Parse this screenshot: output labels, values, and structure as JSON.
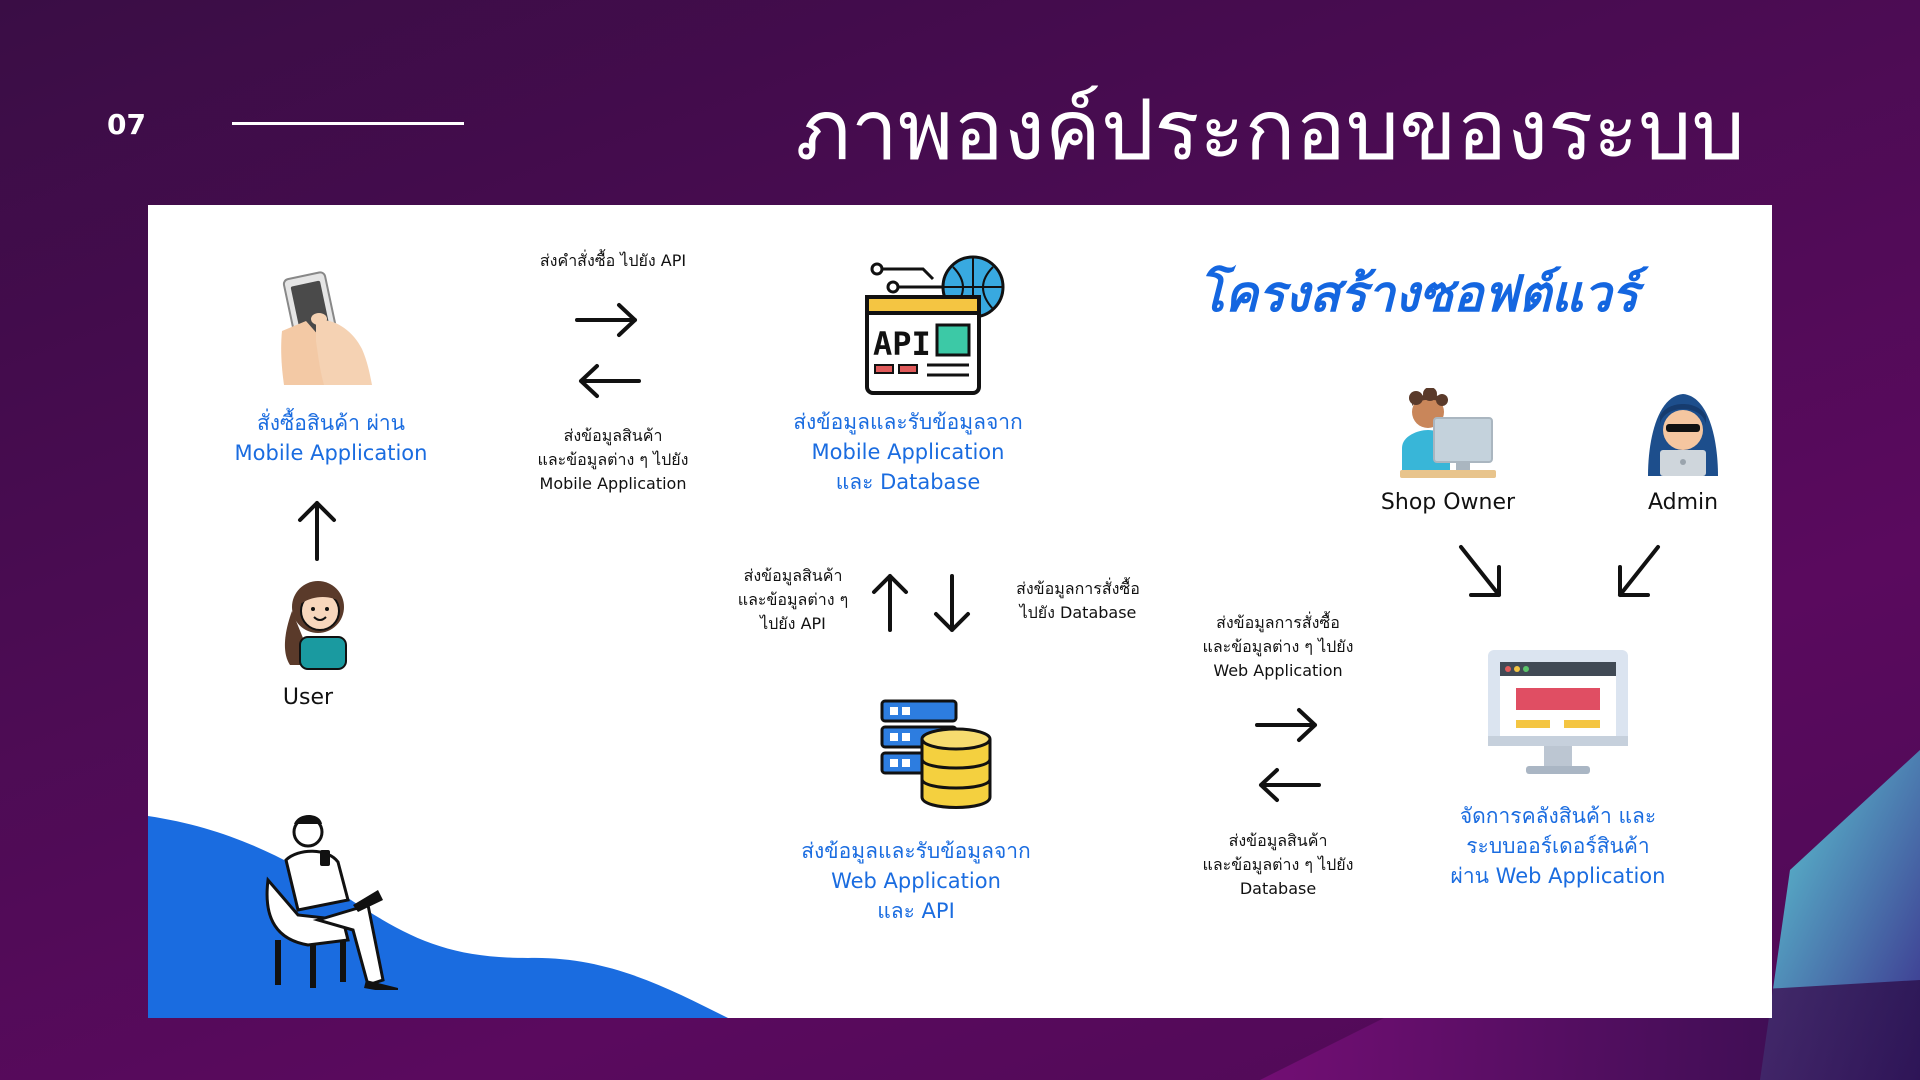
{
  "slide": {
    "number": "07",
    "title": "ภาพองค์ประกอบของระบบ"
  },
  "diagram": {
    "heading": "โครงสร้างซอฟต์แวร์",
    "user": {
      "label": "User",
      "action_lines": [
        "สั่งซื้อสินค้า ผ่าน",
        "Mobile Application"
      ]
    },
    "api": {
      "lines": [
        "ส่งข้อมูลและรับข้อมูลจาก",
        "Mobile Application",
        "และ Database"
      ]
    },
    "database": {
      "lines": [
        "ส่งข้อมูลและรับข้อมูลจาก",
        "Web Application",
        "และ API"
      ]
    },
    "web_app": {
      "lines": [
        "จัดการคลังสินค้า และ",
        "ระบบออร์เดอร์สินค้า",
        "ผ่าน Web Application"
      ]
    },
    "shop_owner": {
      "label": "Shop Owner"
    },
    "admin": {
      "label": "Admin"
    },
    "flows": {
      "mobile_to_api": {
        "lines": [
          "ส่งคำสั่งซื้อ ไปยัง API"
        ]
      },
      "api_to_mobile": {
        "lines": [
          "ส่งข้อมูลสินค้า",
          "และข้อมูลต่าง ๆ ไปยัง",
          "Mobile Application"
        ]
      },
      "db_to_api": {
        "lines": [
          "ส่งข้อมูลสินค้า",
          "และข้อมูลต่าง ๆ",
          "ไปยัง API"
        ]
      },
      "api_to_db": {
        "lines": [
          "ส่งข้อมูลการสั่งซื้อ",
          "ไปยัง Database"
        ]
      },
      "db_to_web": {
        "lines": [
          "ส่งข้อมูลการสั่งซื้อ",
          "และข้อมูลต่าง ๆ ไปยัง",
          "Web Application"
        ]
      },
      "web_to_db": {
        "lines": [
          "ส่งข้อมูลสินค้า",
          "และข้อมูลต่าง ๆ ไปยัง",
          "Database"
        ]
      }
    },
    "icons": {
      "phone": "hand-holding-phone-icon",
      "user": "woman-avatar-icon",
      "api": "api-browser-icon",
      "database": "database-server-icon",
      "web": "web-monitor-icon",
      "shop_owner": "man-at-computer-icon",
      "admin": "hooded-hacker-icon",
      "illustration": "man-sitting-with-phone-illustration"
    },
    "colors": {
      "accent": "#1a6ce0",
      "wave": "#1a6ce0"
    }
  }
}
